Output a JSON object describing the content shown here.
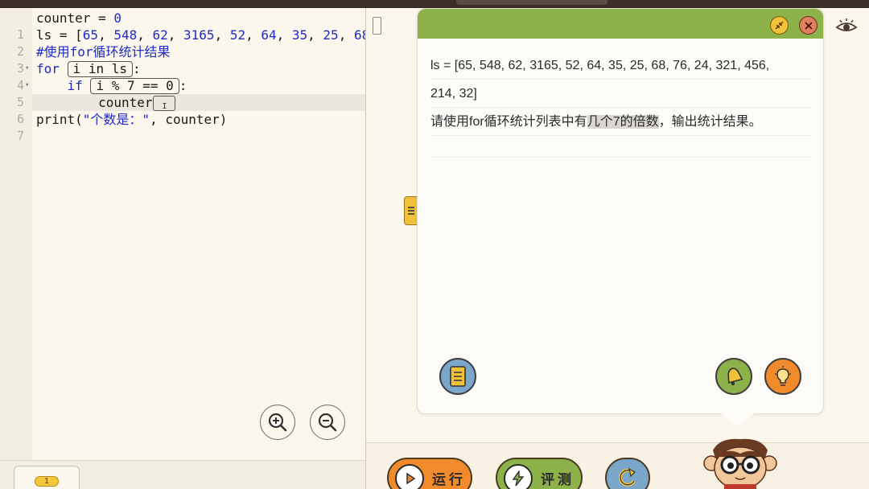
{
  "editor": {
    "lines": [
      {
        "n": "1",
        "fold": "",
        "text": "counter = 0"
      },
      {
        "n": "2",
        "fold": "",
        "text": "ls = [65, 548, 62, 3165, 52, 64, 35, 25, 68"
      },
      {
        "n": "3",
        "fold": "",
        "text": "#使用for循环统计结果"
      },
      {
        "n": "4",
        "fold": "▾",
        "text": "for  i in ls :"
      },
      {
        "n": "5",
        "fold": "▾",
        "text": "    if  i % 7 == 0  :"
      },
      {
        "n": "6",
        "fold": "",
        "text": "        counter"
      },
      {
        "n": "7",
        "fold": "",
        "text": "print(\"个数是: \", counter)"
      }
    ],
    "tokens": {
      "for": "for",
      "for_slot": "i in ls",
      "colon": ":",
      "if": "if",
      "if_slot": "i % 7 == 0",
      "counter_kw": "counter",
      "print_fn": "print(",
      "print_str": "\"个数是：\"",
      "print_rest": ", counter)"
    },
    "zoom_in_icon": "zoom-in-icon",
    "zoom_out_icon": "zoom-out-icon",
    "page_badge": "1"
  },
  "task": {
    "line1": "ls = [65, 548, 62, 3165, 52, 64, 35, 25, 68, 76, 24, 321, 456,",
    "line2": "214, 32]",
    "line3_pre": "请使用for循环统计列表中有",
    "line3_hl": "几个7的倍数",
    "line3_post": "，输出统计结果。"
  },
  "actions": {
    "run": "运行",
    "evaluate": "评测"
  },
  "colors": {
    "header_green": "#8db24a",
    "accent_yellow": "#f2c13a",
    "run_orange": "#f08a2a",
    "eval_green": "#8db24a",
    "reset_blue": "#7aa7c9",
    "keyword_blue": "#1e2bc8"
  }
}
